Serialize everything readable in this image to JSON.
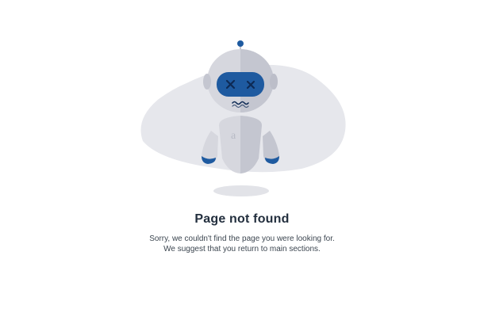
{
  "illustration": {
    "name": "broken-robot",
    "chest_letter": "a",
    "colors": {
      "background_blob": "#e6e7ec",
      "robot_body": "#d6d7de",
      "robot_body_shade": "#c4c6d0",
      "visor": "#1e5aa0",
      "visor_eyes": "#0d2a55",
      "arm_accent": "#1e5aa0",
      "shadow": "#e2e3e8"
    }
  },
  "error": {
    "title": "Page not found",
    "message_line1": "Sorry, we couldn't find the page you were looking for.",
    "message_line2": "We suggest that you return to main sections."
  }
}
